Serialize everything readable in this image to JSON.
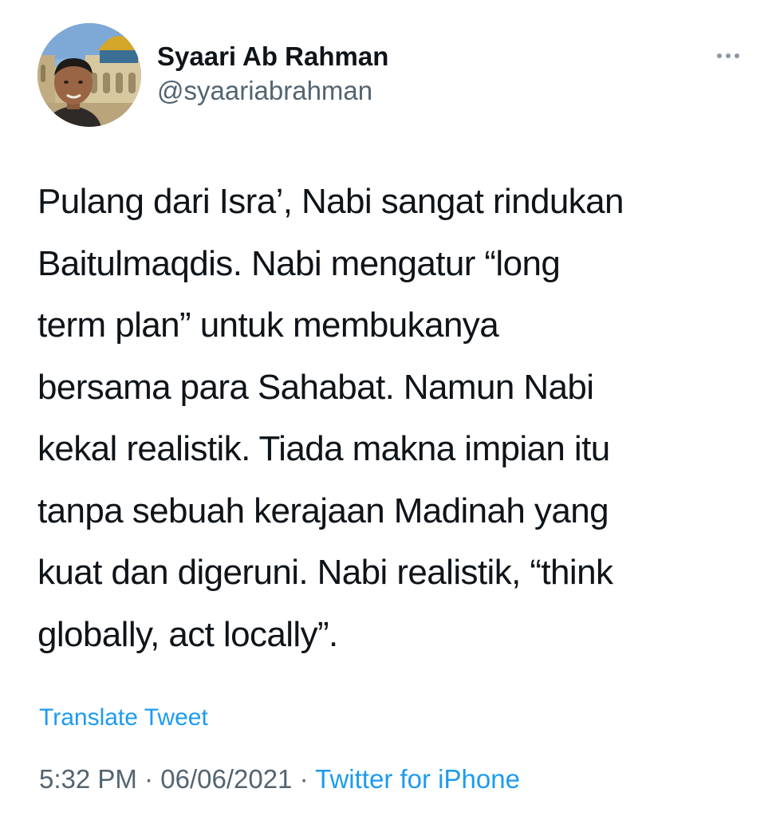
{
  "author": {
    "display_name": "Syaari Ab Rahman",
    "handle": "@syaariabrahman"
  },
  "tweet": {
    "text": "Pulang dari Isra’, Nabi sangat rindukan\nBaitulmaqdis. Nabi mengatur “long\nterm plan” untuk membukanya\nbersama para Sahabat. Namun Nabi\nkekal realistik. Tiada makna impian itu\ntanpa sebuah kerajaan Madinah yang\nkuat dan digeruni. Nabi realistik, “think\nglobally, act locally”.",
    "translate_label": "Translate Tweet"
  },
  "meta": {
    "time": "5:32 PM",
    "separator": " · ",
    "date": "06/06/2021",
    "source": "Twitter for iPhone"
  },
  "icons": {
    "more": "more-horizontal-icon"
  },
  "colors": {
    "link": "#1d9bf0",
    "secondary_text": "#536471",
    "primary_text": "#0f1419"
  }
}
